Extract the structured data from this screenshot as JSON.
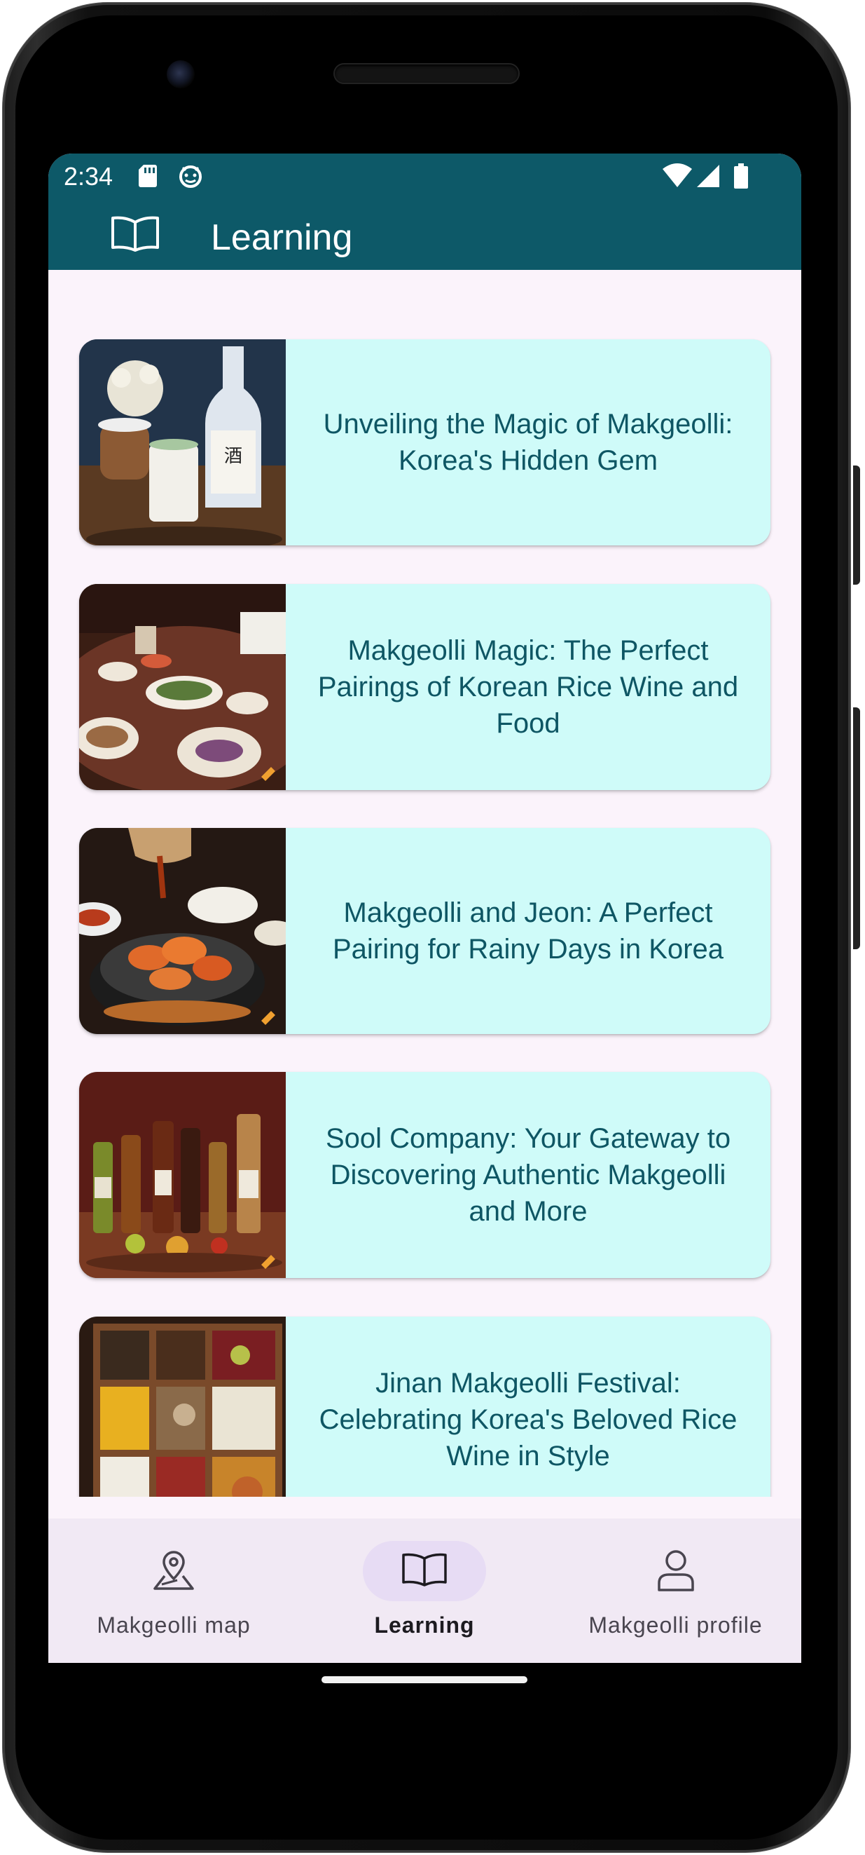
{
  "status_bar": {
    "time": "2:34",
    "icons": [
      "sd-card-icon",
      "android-debug-icon",
      "wifi-icon",
      "signal-icon",
      "battery-icon"
    ]
  },
  "app_bar": {
    "icon": "book-open-icon",
    "title": "Learning",
    "background": "#0d5968"
  },
  "articles": [
    {
      "title": "Unveiling the Magic of Makgeolli: Korea's Hidden Gem",
      "image": "makgeolli-bottle-photo"
    },
    {
      "title": "Makgeolli Magic: The Perfect Pairings of Korean Rice Wine and Food",
      "image": "korean-dinner-table-photo"
    },
    {
      "title": "Makgeolli and Jeon: A Perfect Pairing for Rainy Days in Korea",
      "image": "jeon-pan-photo"
    },
    {
      "title": "Sool Company: Your Gateway to Discovering Authentic Makgeolli and More",
      "image": "bottles-lineup-photo"
    },
    {
      "title": "Jinan Makgeolli Festival: Celebrating Korea's Beloved Rice Wine in Style",
      "image": "ingredient-box-photo"
    }
  ],
  "bottom_nav": {
    "items": [
      {
        "label": "Makgeolli map",
        "icon": "map-pin-icon",
        "active": false
      },
      {
        "label": "Learning",
        "icon": "book-open-icon",
        "active": true
      },
      {
        "label": "Makgeolli profile",
        "icon": "person-icon",
        "active": false
      }
    ]
  },
  "colors": {
    "card_background": "#cffbf9",
    "card_text": "#0e5664",
    "screen_background": "#fbf3fb",
    "nav_background": "#f1e9f4",
    "nav_active_indicator": "#e7dcf4"
  }
}
